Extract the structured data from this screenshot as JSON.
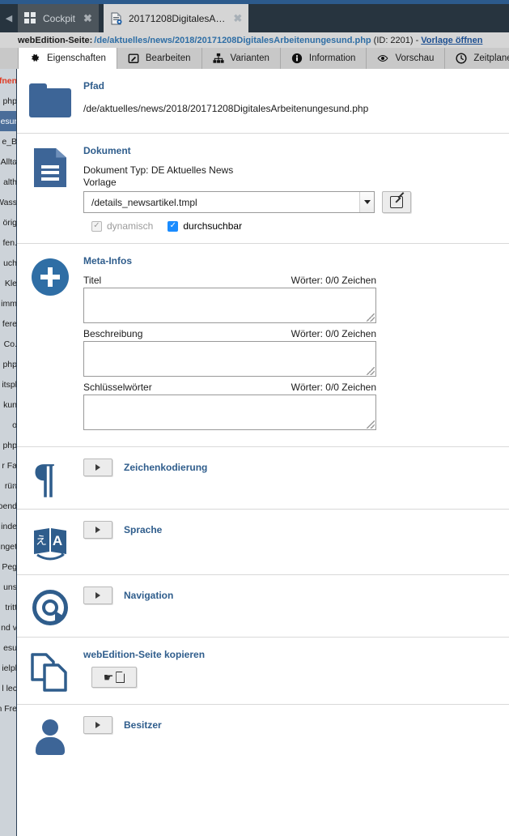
{
  "tabs": {
    "scroll_arrow_icon": "chevron-left-icon",
    "items": [
      {
        "label": "Cockpit",
        "icon": "grid-icon",
        "close_label": "✖",
        "active": false
      },
      {
        "label": "20171208DigitalesA…",
        "icon": "document-icon",
        "close_label": "✖",
        "active": true
      }
    ]
  },
  "breadcrumb": {
    "prefix": "webEdition-Seite",
    "colon": ":",
    "path": "/de/aktuelles/news/2018/20171208DigitalesArbeitenungesund.php",
    "id_text": "(ID: 2201)",
    "separator": "-",
    "link": "Vorlage öffnen"
  },
  "section_tabs": [
    {
      "label": "Eigenschaften",
      "icon": "gear-icon",
      "glyph": "⚙",
      "active": true
    },
    {
      "label": "Bearbeiten",
      "icon": "pencil-square-icon",
      "glyph": "✎",
      "active": false
    },
    {
      "label": "Varianten",
      "icon": "hierarchy-icon",
      "glyph": "⛓",
      "active": false
    },
    {
      "label": "Information",
      "icon": "info-circle-icon",
      "glyph": "ℹ",
      "active": false
    },
    {
      "label": "Vorschau",
      "icon": "eye-icon",
      "glyph": "◉",
      "active": false
    },
    {
      "label": "Zeitplaner",
      "icon": "clock-icon",
      "glyph": "◴",
      "active": false
    }
  ],
  "sidebar": {
    "clipped_rows": [
      {
        "text": "fnen",
        "style": "red"
      },
      {
        "text": "php",
        "style": "normal"
      },
      {
        "text": "esur",
        "style": "selected"
      },
      {
        "text": "e_B",
        "style": "normal"
      },
      {
        "text": "Allta",
        "style": "normal"
      },
      {
        "text": "alth",
        "style": "normal"
      },
      {
        "text": "Wass",
        "style": "normal"
      },
      {
        "text": "örig",
        "style": "normal"
      },
      {
        "text": "fen.",
        "style": "normal"
      },
      {
        "text": "uch",
        "style": "normal"
      },
      {
        "text": "Kle",
        "style": "normal"
      },
      {
        "text": "imm",
        "style": "normal"
      },
      {
        "text": "fere",
        "style": "normal"
      },
      {
        "text": "Co.",
        "style": "normal"
      },
      {
        "text": "php",
        "style": "normal"
      },
      {
        "text": "itspl",
        "style": "normal"
      },
      {
        "text": "kun",
        "style": "normal"
      },
      {
        "text": "o",
        "style": "normal"
      },
      {
        "text": "php",
        "style": "normal"
      },
      {
        "text": "r Fa",
        "style": "normal"
      },
      {
        "text": "rün",
        "style": "normal"
      },
      {
        "text": "oend",
        "style": "normal"
      },
      {
        "text": "inde",
        "style": "normal"
      },
      {
        "text": "nget",
        "style": "normal"
      },
      {
        "text": "Peg",
        "style": "normal"
      },
      {
        "text": "uns",
        "style": "normal"
      },
      {
        "text": "tritt",
        "style": "normal"
      },
      {
        "text": "nd v",
        "style": "normal"
      },
      {
        "text": "esu",
        "style": "normal"
      },
      {
        "text": "ielpl",
        "style": "normal"
      },
      {
        "text": "l lec",
        "style": "normal"
      },
      {
        "text": "n Fre",
        "style": "normal"
      }
    ]
  },
  "sections": {
    "pfad": {
      "icon": "folder-icon",
      "title": "Pfad",
      "value": "/de/aktuelles/news/2018/20171208DigitalesArbeitenungesund.php"
    },
    "dokument": {
      "icon": "document-icon",
      "title": "Dokument",
      "type_label": "Dokument Typ: DE Aktuelles News",
      "vorlage_label": "Vorlage",
      "template_value": "/details_newsartikel.tmpl",
      "dropdown_arrow_icon": "chevron-down-icon",
      "edit_button_icon": "pencil-square-icon",
      "checkboxes": [
        {
          "label": "dynamisch",
          "checked": true,
          "disabled": true,
          "mark": "✓"
        },
        {
          "label": "durchsuchbar",
          "checked": true,
          "disabled": false,
          "mark": "✓"
        }
      ]
    },
    "meta": {
      "icon": "plus-circle-icon",
      "title": "Meta-Infos",
      "fields": [
        {
          "label": "Titel",
          "counter": "Wörter: 0/0 Zeichen",
          "value": ""
        },
        {
          "label": "Beschreibung",
          "counter": "Wörter: 0/0 Zeichen",
          "value": ""
        },
        {
          "label": "Schlüsselwörter",
          "counter": "Wörter: 0/0 Zeichen",
          "value": ""
        }
      ]
    },
    "zeichenkodierung": {
      "icon": "pilcrow-icon",
      "title": "Zeichenkodierung",
      "expander_icon": "caret-right-icon"
    },
    "sprache": {
      "icon": "translate-icon",
      "title": "Sprache",
      "expander_icon": "caret-right-icon"
    },
    "navigation": {
      "icon": "compass-icon",
      "title": "Navigation",
      "expander_icon": "caret-right-icon"
    },
    "kopieren": {
      "icon": "copy-pages-icon",
      "title": "webEdition-Seite kopieren",
      "button_icons": [
        "hand-pointer-icon",
        "page-icon"
      ]
    },
    "besitzer": {
      "icon": "user-icon",
      "title": "Besitzer",
      "expander_icon": "caret-right-icon"
    }
  },
  "colors": {
    "accent_blue": "#2c5a8c",
    "title_blue": "#2f5d8c",
    "link_blue": "#1d4f91",
    "tabbar_dark": "#27343f",
    "checkbox_on": "#1a8cff",
    "sidebar_bg": "#cdd3d9",
    "sidebar_selected": "#4a6d99",
    "sidebar_red": "#e03b23"
  }
}
